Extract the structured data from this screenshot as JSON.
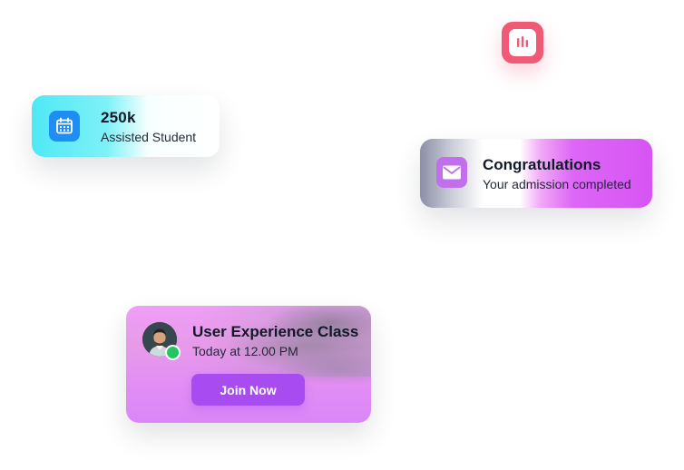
{
  "stats_card": {
    "icon": "calendar-icon",
    "count": "250k",
    "label": "Assisted Student"
  },
  "chart_badge": {
    "icon": "bar-chart-icon",
    "color": "#f05a76"
  },
  "notification_card": {
    "icon": "mail-icon",
    "title": "Congratulations",
    "message": "Your admission completed"
  },
  "class_card": {
    "avatar": "avatar",
    "status": "online",
    "title": "User Experience Class",
    "time": "Today at 12.00 PM",
    "button_label": "Join Now",
    "button_color": "#a84cf2"
  }
}
